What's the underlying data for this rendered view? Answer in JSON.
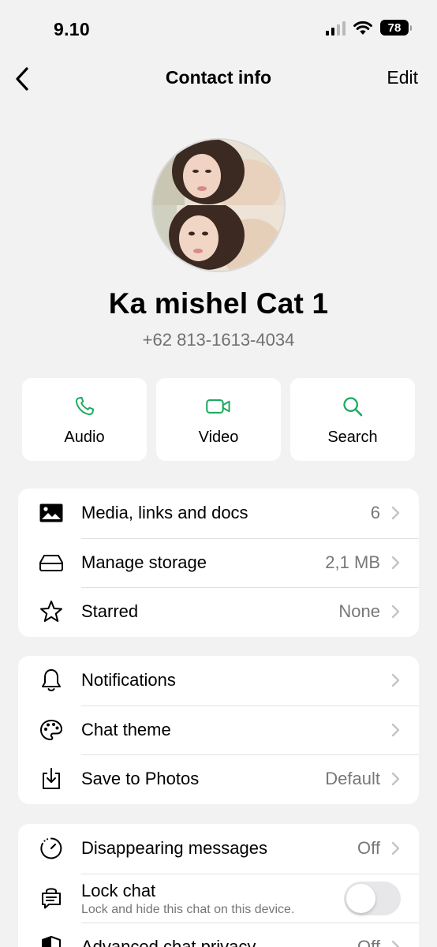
{
  "status_bar": {
    "time": "9.10",
    "battery": "78"
  },
  "nav": {
    "title": "Contact info",
    "edit_label": "Edit"
  },
  "contact": {
    "name": "Ka mishel Cat 1",
    "phone": "+62 813-1613-4034"
  },
  "actions": [
    {
      "label": "Audio",
      "icon": "phone-icon"
    },
    {
      "label": "Video",
      "icon": "video-icon"
    },
    {
      "label": "Search",
      "icon": "search-icon"
    }
  ],
  "group1": [
    {
      "label": "Media, links and docs",
      "value": "6",
      "icon": "image-icon"
    },
    {
      "label": "Manage storage",
      "value": "2,1 MB",
      "icon": "storage-icon"
    },
    {
      "label": "Starred",
      "value": "None",
      "icon": "star-icon"
    }
  ],
  "group2": [
    {
      "label": "Notifications",
      "value": "",
      "icon": "bell-icon"
    },
    {
      "label": "Chat theme",
      "value": "",
      "icon": "palette-icon"
    },
    {
      "label": "Save to Photos",
      "value": "Default",
      "icon": "download-icon"
    }
  ],
  "group3": [
    {
      "label": "Disappearing messages",
      "value": "Off",
      "icon": "timer-icon"
    },
    {
      "label": "Lock chat",
      "sublabel": "Lock and hide this chat on this device.",
      "toggle_on": false,
      "icon": "lock-chat-icon"
    },
    {
      "label": "Advanced chat privacy",
      "value": "Off",
      "icon": "shield-icon"
    }
  ],
  "colors": {
    "accent_green": "#1DAA61",
    "background": "#F2F2F2",
    "card": "#FFFFFF",
    "secondary_text": "#777777"
  }
}
